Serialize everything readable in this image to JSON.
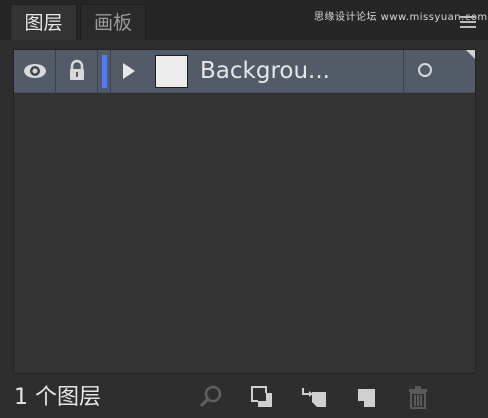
{
  "tabs": [
    {
      "label": "图层",
      "active": true
    },
    {
      "label": "画板",
      "active": false
    }
  ],
  "watermark": "思缘设计论坛 www.missyuan.com",
  "layers": [
    {
      "name": "Backgrou...",
      "visible": true,
      "locked": true,
      "color": "#4f7cff"
    }
  ],
  "footer": {
    "layer_count": "1 个图层"
  },
  "icons": {
    "menu": "hamburger-menu-icon",
    "visibility": "eye-icon",
    "lock": "lock-icon",
    "expand": "expand-arrow-icon",
    "target": "target-circle-icon",
    "search": "search-icon",
    "clipping_mask": "clipping-mask-icon",
    "new_sublayer": "new-sublayer-icon",
    "new_layer": "new-layer-icon",
    "delete": "trash-icon"
  },
  "colors": {
    "selected_row": "#535b68",
    "layer_color": "#4f7cff"
  }
}
